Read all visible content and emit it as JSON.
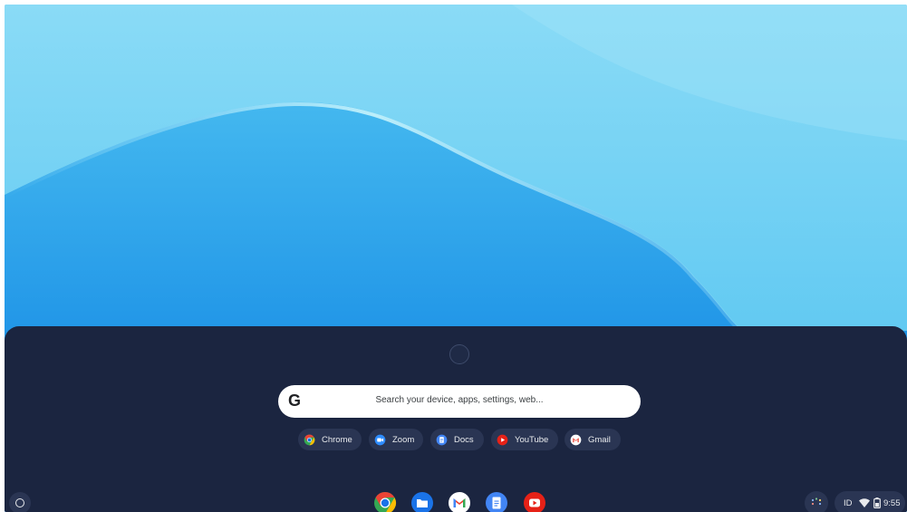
{
  "launcher": {
    "search_placeholder": "Search your device, apps, settings, web...",
    "google_logo": "G",
    "suggested_apps": [
      {
        "label": "Chrome",
        "icon": "chrome-icon"
      },
      {
        "label": "Zoom",
        "icon": "zoom-icon"
      },
      {
        "label": "Docs",
        "icon": "docs-icon"
      },
      {
        "label": "YouTube",
        "icon": "youtube-icon"
      },
      {
        "label": "Gmail",
        "icon": "gmail-icon"
      }
    ]
  },
  "shelf": {
    "pinned_apps": [
      "chrome-icon",
      "files-icon",
      "gmail-icon",
      "docs-icon",
      "youtube-icon"
    ],
    "status": {
      "ime": "ID",
      "time": "9:55"
    }
  },
  "colors": {
    "launcher_bg": "#1b2540",
    "chip_bg": "#2a3553",
    "chrome_red": "#ea4335",
    "chrome_yellow": "#fbbc04",
    "chrome_green": "#34a853",
    "google_blue": "#1a73e8",
    "youtube_red": "#e62117"
  }
}
